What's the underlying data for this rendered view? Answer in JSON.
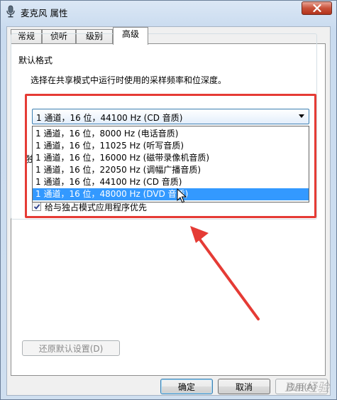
{
  "window": {
    "title": "麦克风 属性"
  },
  "tabs": [
    {
      "label": "常规"
    },
    {
      "label": "侦听"
    },
    {
      "label": "级别"
    },
    {
      "label": "高级"
    }
  ],
  "default_format": {
    "group_title": "默认格式",
    "description": "选择在共享模式中运行时使用的采样频率和位深度。",
    "selected_value": "1 通道，16 位，44100 Hz (CD 音质)",
    "options": [
      "1 通道，16 位，8000 Hz (电话音质)",
      "1 通道，16 位，11025 Hz (听写音质)",
      "1 通道，16 位，16000 Hz (磁带录像机音质)",
      "1 通道，16 位，22050 Hz (调幅广播音质)",
      "1 通道，16 位，44100 Hz (CD 音质)",
      "1 通道，16 位，48000 Hz (DVD 音质)"
    ],
    "highlighted_index": 5
  },
  "exclusive": {
    "priority_label": "给与独占模式应用程序优先",
    "priority_checked": true
  },
  "buttons": {
    "restore_defaults": "还原默认设置(D)",
    "ok": "确定",
    "cancel": "取消",
    "apply": "应用(A)"
  },
  "watermark": "Bai经验",
  "colors": {
    "highlight": "#3399ff",
    "annotation_red": "#e53b35"
  }
}
